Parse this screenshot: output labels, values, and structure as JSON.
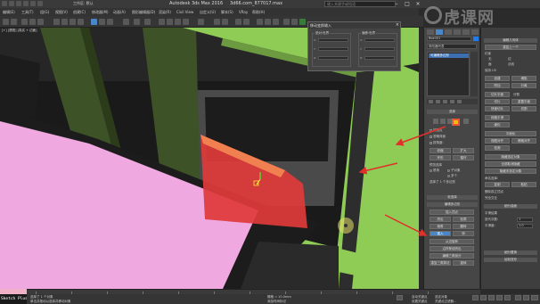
{
  "window": {
    "app_title": "Autodesk 3ds Max 2016",
    "file_title": "3d66.com_877017.max",
    "workspace_label": "工作区: 默认",
    "search_placeholder": "键入关键字或短语"
  },
  "menubar": {
    "items": [
      "编辑(E)",
      "工具(T)",
      "组(G)",
      "视图(V)",
      "创建(C)",
      "修改器(M)",
      "动画(A)",
      "图形编辑器(D)",
      "渲染(R)",
      "Civil View",
      "自定义(U)",
      "脚本(S)",
      "VRay",
      "帮助(H)"
    ]
  },
  "viewport": {
    "label": "[+] [透视] [真实 + 边面]"
  },
  "float_dialog": {
    "title": "移动变换输入",
    "group_left": "绝对:世界",
    "group_right": "偏移:世界",
    "axis_labels": [
      "X:",
      "Y:",
      "Z:"
    ]
  },
  "command_panel": {
    "object_name": "Box001",
    "modifier_list": "修改器列表",
    "stack_item": "可编辑多边形",
    "rollouts": {
      "selection": "选择",
      "soft_selection": "软选择",
      "edit_polygons": "编辑多边形"
    },
    "selection_rows": [
      "按顶点",
      "忽略背面",
      "按角度:",
      "收缩",
      "扩大",
      "环形",
      "循环"
    ],
    "preview_label": "预览选择",
    "preview_options": [
      "禁用",
      "子对象",
      "多个"
    ],
    "status": "选择了 1 个多边形",
    "edit_buttons": [
      "插入顶点",
      "挤出",
      "轮廓",
      "倒角",
      "插入",
      "桥",
      "翻转",
      "从边旋转",
      "沿样条线挤出",
      "编辑三角剖分",
      "重复三角算法",
      "旋转"
    ]
  },
  "side_panel": {
    "titles": [
      "编辑几何体",
      "细分曲面",
      "细分置换",
      "绘制变形"
    ],
    "rows": [
      "重复上一个",
      "约束",
      "无",
      "边",
      "面",
      "法线",
      "保持 UV",
      "创建",
      "塌陷",
      "附加",
      "分离",
      "切片平面",
      "分割",
      "切片",
      "重置平面",
      "快速切片",
      "切割",
      "网格平滑",
      "细化",
      "平面化",
      "视图对齐",
      "栅格对齐",
      "松弛",
      "隐藏选定对象",
      "全部取消隐藏",
      "隐藏未选定对象",
      "命名选择:",
      "复制",
      "粘贴",
      "删除孤立顶点",
      "完全交互"
    ],
    "smooth_label": "平滑结果",
    "iterations_label": "迭代次数:",
    "smoothness_label": "平滑度:",
    "iterations_value": "1",
    "smoothness_value": "1.0"
  },
  "statusbar": {
    "maxscript": "Sketch Plus",
    "status_text": "选择了 1 个对象",
    "prompt_text": "单击并拖动以选择并移动对象",
    "add_time_tag": "添加时间标记",
    "grid_label": "栅格 = 10.0mm",
    "auto_key": "自动关键点",
    "selected": "选定对象",
    "set_key": "设置关键点",
    "key_filters": "关键点过滤器..."
  },
  "colors": {
    "green_wall": "#8fcc55",
    "dark_green": "#3d5226",
    "pink_floor": "#f0a8e0",
    "red_selection": "#e03a3a",
    "arrow_red": "#e0302a"
  }
}
